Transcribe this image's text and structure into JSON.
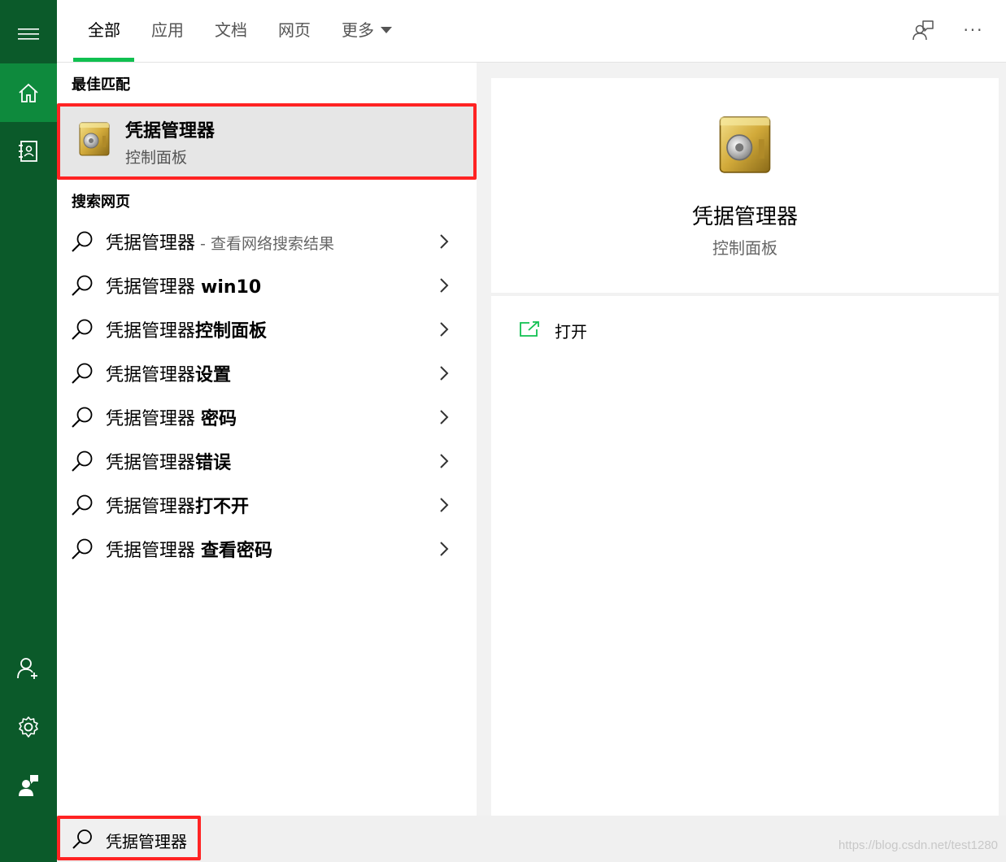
{
  "rail": {
    "items": [
      {
        "icon": "hamburger-menu-icon"
      },
      {
        "icon": "home-icon",
        "active": true
      },
      {
        "icon": "notebook-icon"
      },
      {
        "icon": "add-user-icon"
      },
      {
        "icon": "settings-gear-icon"
      },
      {
        "icon": "feedback-person-icon"
      }
    ]
  },
  "tabs": [
    {
      "label": "全部",
      "active": true
    },
    {
      "label": "应用"
    },
    {
      "label": "文档"
    },
    {
      "label": "网页"
    },
    {
      "label": "更多"
    }
  ],
  "top_icons": [
    "feedback-chat-icon",
    "more-options-icon"
  ],
  "top_more_text": "···",
  "best_match": {
    "section_title": "最佳匹配",
    "title": "凭据管理器",
    "subtitle": "控制面板",
    "icon": "vault-safe-icon"
  },
  "web_search": {
    "section_title": "搜索网页",
    "items": [
      {
        "prefix": "凭据管理器",
        "suffix": "",
        "muted": " - 查看网络搜索结果"
      },
      {
        "prefix": "凭据管理器 ",
        "suffix": "win10",
        "muted": ""
      },
      {
        "prefix": "凭据管理器",
        "suffix": "控制面板",
        "muted": ""
      },
      {
        "prefix": "凭据管理器",
        "suffix": "设置",
        "muted": ""
      },
      {
        "prefix": "凭据管理器 ",
        "suffix": "密码",
        "muted": ""
      },
      {
        "prefix": "凭据管理器",
        "suffix": "错误",
        "muted": ""
      },
      {
        "prefix": "凭据管理器",
        "suffix": "打不开",
        "muted": ""
      },
      {
        "prefix": "凭据管理器 ",
        "suffix": "查看密码",
        "muted": ""
      }
    ]
  },
  "detail": {
    "title": "凭据管理器",
    "subtitle": "控制面板",
    "actions": [
      {
        "label": "打开",
        "icon": "open-external-icon"
      }
    ]
  },
  "search": {
    "query": "凭据管理器"
  },
  "watermark": "https://blog.csdn.net/test1280",
  "colors": {
    "rail_bg": "#0b5a2a",
    "rail_active": "#0e8a3d",
    "accent": "#10c050",
    "highlight_border": "#ff2323"
  }
}
